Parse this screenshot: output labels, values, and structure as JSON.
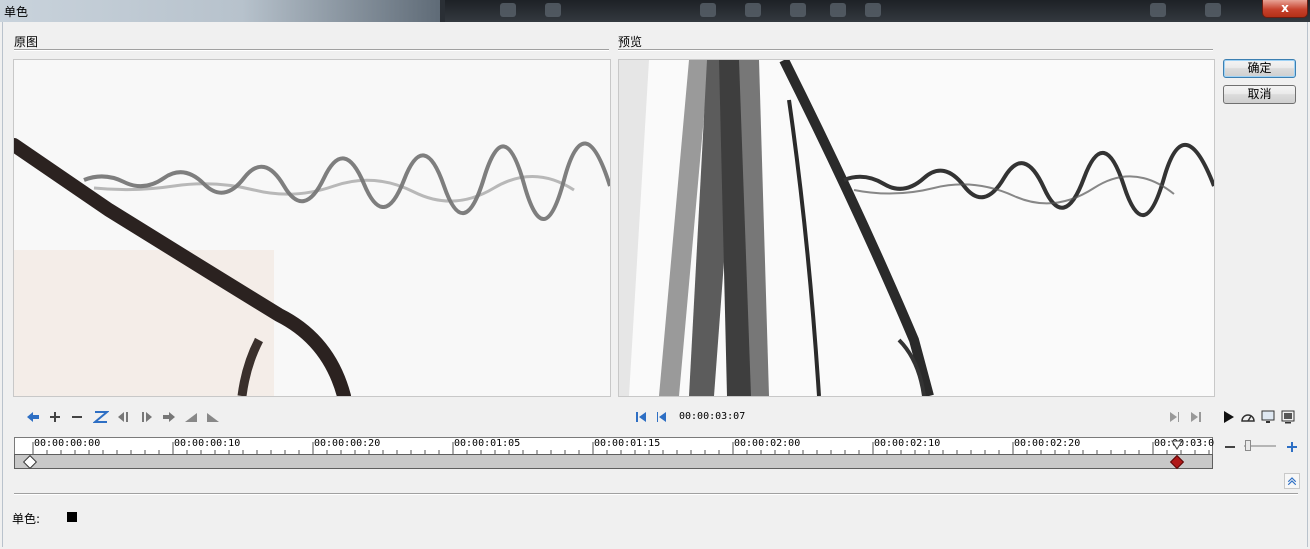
{
  "window": {
    "title": "单色",
    "close_label": "x"
  },
  "panels": {
    "original_label": "原图",
    "preview_label": "预览"
  },
  "buttons": {
    "ok": "确定",
    "cancel": "取消"
  },
  "playback": {
    "current_timecode": "00:00:03:07"
  },
  "timeline": {
    "ticks": [
      "00:00:00:00",
      "00:00:00:10",
      "00:00:00:20",
      "00:00:01:05",
      "00:00:01:15",
      "00:00:02:00",
      "00:00:02:10",
      "00:00:02:20",
      "00:00:03:0"
    ],
    "playhead_position": 0.97
  },
  "properties": {
    "color_label": "单色:",
    "color_value": "#000000"
  },
  "colors": {
    "accent_blue": "#2e6fc4",
    "keyframe_red": "#b01818",
    "ok_border": "#3c7fb1"
  },
  "icons": {
    "left_toolbar": [
      "goto-prev-keyframe-icon",
      "add-keyframe-icon",
      "remove-keyframe-icon",
      "reverse-keyframes-icon",
      "move-keyframe-left-icon",
      "move-keyframe-right-icon",
      "goto-next-keyframe-icon",
      "fade-in-icon",
      "fade-out-icon"
    ],
    "center_toolbar": [
      "go-to-start-icon",
      "previous-frame-icon"
    ],
    "right_toolbar": [
      "next-frame-icon",
      "go-to-end-icon",
      "play-icon",
      "playback-speed-icon",
      "preview-window-icon",
      "device-preview-icon"
    ]
  }
}
